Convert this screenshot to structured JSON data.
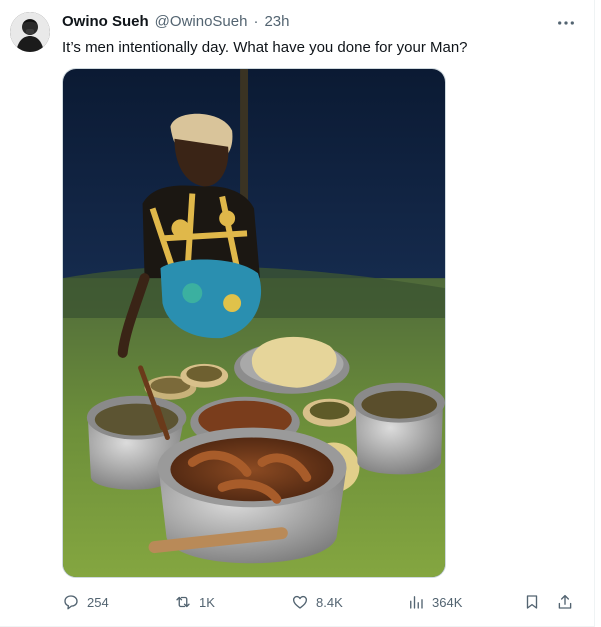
{
  "author": {
    "name": "Owino Sueh",
    "handle": "@OwinoSueh",
    "separator": "·",
    "time": "23h"
  },
  "tweet": {
    "text": "It’s men intentionally day. What have you done for your Man?"
  },
  "actions": {
    "replies": "254",
    "reposts": "1K",
    "likes": "8.4K",
    "views": "364K"
  },
  "icons": {
    "more": "more-dots-icon",
    "reply": "reply-icon",
    "repost": "repost-icon",
    "like": "heart-icon",
    "views": "views-chart-icon",
    "bookmark": "bookmark-icon",
    "share": "share-icon"
  },
  "colors": {
    "text_primary": "#0f1419",
    "text_secondary": "#536471",
    "border": "#cfd9de"
  }
}
